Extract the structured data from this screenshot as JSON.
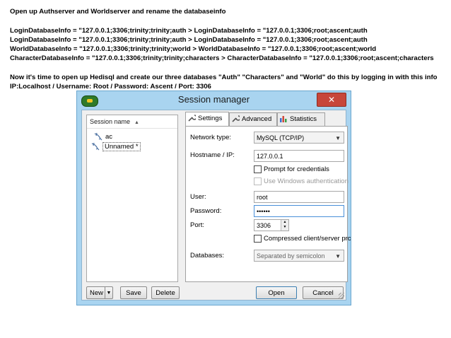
{
  "doc": {
    "heading": "Open up Authserver and Worldserver and rename the databaseinfo",
    "lines": [
      "LoginDatabaseInfo = \"127.0.0.1;3306;trinity;trinity;auth > LoginDatabaseInfo = \"127.0.0.1;3306;root;ascent;auth",
      "LoginDatabaseInfo = \"127.0.0.1;3306;trinity;trinity;auth > LoginDatabaseInfo = \"127.0.0.1;3306;root;ascent;auth",
      "WorldDatabaseInfo = \"127.0.0.1;3306;trinity;trinity;world > WorldDatabaseInfo = \"127.0.0.1;3306;root;ascent;world",
      "CharacterDatabaseInfo = \"127.0.0.1;3306;trinity;trinity;characters > CharacterDatabaseInfo = \"127.0.0.1;3306;root;ascent;characters"
    ],
    "instruction_1": "Now it's time to open up Hedisql and create our three databases \"Auth\" \"Characters\" and \"World\" do this by logging in with this info",
    "instruction_2": "IP:Localhost / Username: Root / Password: Ascent / Port: 3306"
  },
  "window": {
    "title": "Session manager",
    "close_label": "✕"
  },
  "sessions": {
    "column_header": "Session name",
    "sort_glyph": "▲",
    "items": [
      "ac",
      "Unnamed *"
    ]
  },
  "tabs": [
    "Settings",
    "Advanced",
    "Statistics"
  ],
  "settings": {
    "network_type_label": "Network type:",
    "network_type_value": "MySQL (TCP/IP)",
    "hostname_label": "Hostname / IP:",
    "hostname_value": "127.0.0.1",
    "prompt_credentials": "Prompt for credentials",
    "windows_auth": "Use Windows authentication",
    "user_label": "User:",
    "user_value": "root",
    "password_label": "Password:",
    "password_value": "••••••",
    "port_label": "Port:",
    "port_value": "3306",
    "compressed_label": "Compressed client/server prc",
    "databases_label": "Databases:",
    "databases_value": "Separated by semicolon"
  },
  "buttons": {
    "new": "New",
    "save": "Save",
    "delete": "Delete",
    "open": "Open",
    "cancel": "Cancel"
  }
}
